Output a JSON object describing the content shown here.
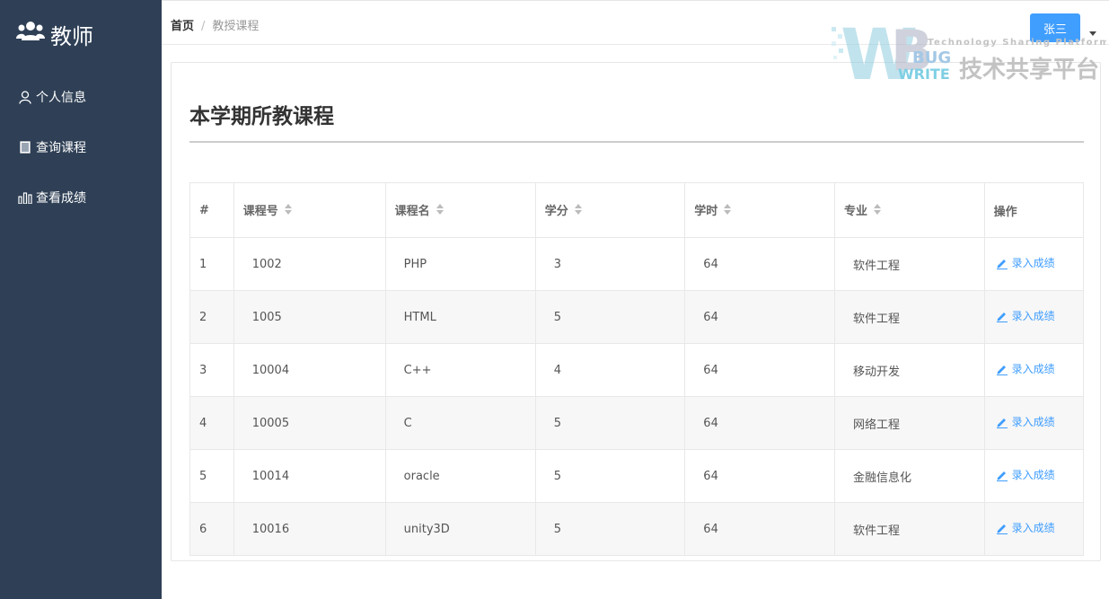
{
  "sidebar": {
    "title": "教师",
    "items": [
      {
        "label": "个人信息",
        "icon": "user-icon"
      },
      {
        "label": "查询课程",
        "icon": "book-icon"
      },
      {
        "label": "查看成绩",
        "icon": "bar-chart-icon"
      }
    ]
  },
  "breadcrumb": {
    "home": "首页",
    "separator": "/",
    "current": "教授课程"
  },
  "header": {
    "user_button": "张三"
  },
  "watermark": {
    "tagline": "Technology Sharing Platform",
    "name": "技术共享平台",
    "logo_bug": "BUG",
    "logo_write": "WRITE"
  },
  "page": {
    "title": "本学期所教课程"
  },
  "table": {
    "columns": [
      "#",
      "课程号",
      "课程名",
      "学分",
      "学时",
      "专业",
      "操作"
    ],
    "action_label": "录入成绩",
    "rows": [
      [
        "1",
        "1002",
        "PHP",
        "3",
        "64",
        "软件工程"
      ],
      [
        "2",
        "1005",
        "HTML",
        "5",
        "64",
        "软件工程"
      ],
      [
        "3",
        "10004",
        "C++",
        "4",
        "64",
        "移动开发"
      ],
      [
        "4",
        "10005",
        "C",
        "5",
        "64",
        "网络工程"
      ],
      [
        "5",
        "10014",
        "oracle",
        "5",
        "64",
        "金融信息化"
      ],
      [
        "6",
        "10016",
        "unity3D",
        "5",
        "64",
        "软件工程"
      ]
    ]
  },
  "colors": {
    "sidebar_bg": "#2f4056",
    "accent": "#409eff"
  }
}
